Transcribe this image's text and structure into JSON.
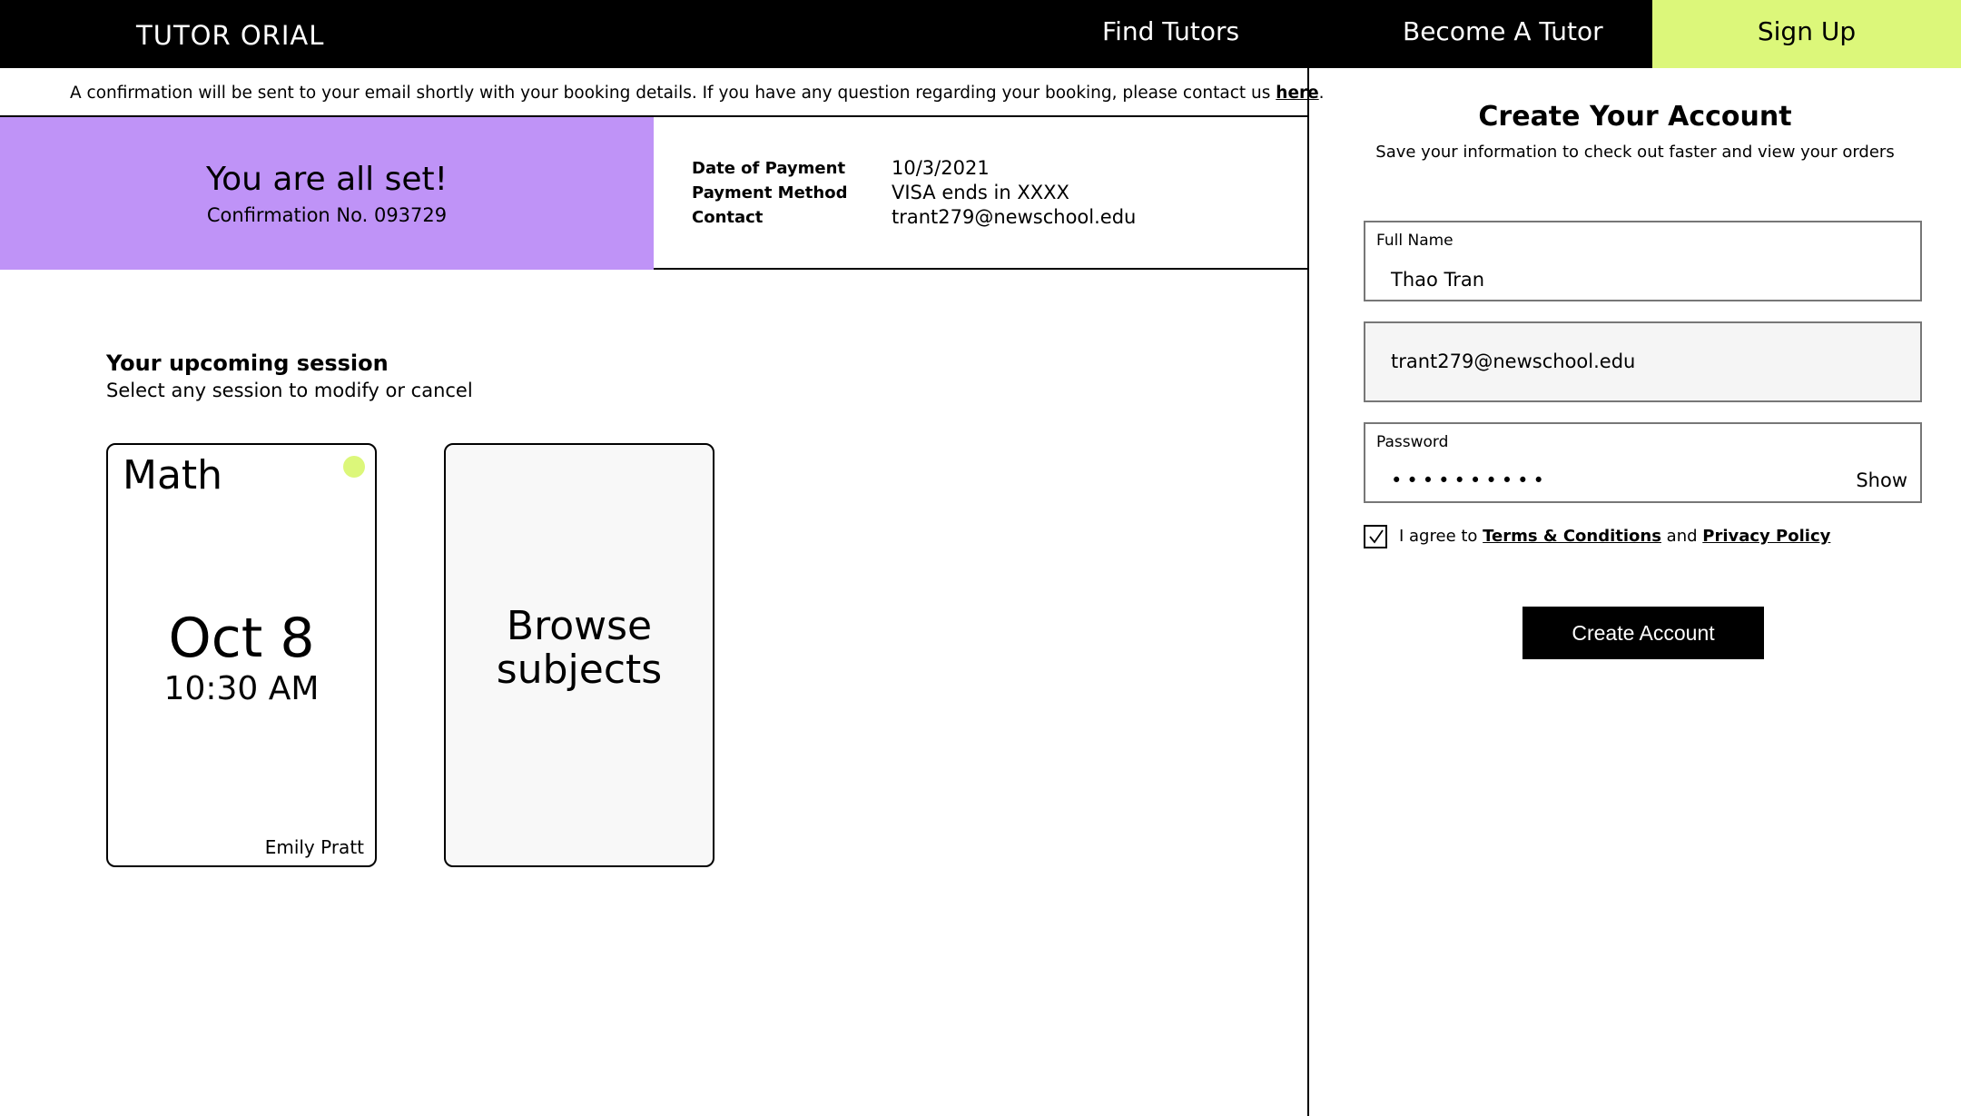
{
  "header": {
    "logo": "TUTOR ORIAL",
    "nav": {
      "find_tutors": "Find Tutors",
      "become_tutor": "Become A Tutor",
      "sign_up": "Sign Up"
    }
  },
  "notice": {
    "text": "A confirmation will be sent to your email shortly with your booking details. If you have any question regarding your booking, please contact us ",
    "link": "here",
    "end": "."
  },
  "confirmation": {
    "title": "You are all set!",
    "subtitle": "Confirmation No. 093729"
  },
  "payment": {
    "date_label": "Date of Payment",
    "date_value": "10/3/2021",
    "method_label": "Payment Method",
    "method_value": "VISA ends in XXXX",
    "contact_label": "Contact",
    "contact_value": "trant279@newschool.edu"
  },
  "sessions": {
    "title": "Your upcoming session",
    "subtitle": "Select any session to modify or cancel",
    "items": [
      {
        "subject": "Math",
        "date": "Oct 8",
        "time": "10:30 AM",
        "tutor": "Emily Pratt"
      }
    ],
    "browse_label": "Browse subjects"
  },
  "account": {
    "title": "Create Your Account",
    "subtitle": "Save your information to check out faster and view your orders",
    "full_name_label": "Full Name",
    "full_name_value": "Thao Tran",
    "email_value": "trant279@newschool.edu",
    "password_label": "Password",
    "password_mask": "••••••••••",
    "show_label": "Show",
    "agree_prefix": "I agree to ",
    "terms_link": "Terms & Conditions",
    "agree_and": " and ",
    "privacy_link": "Privacy Policy",
    "create_button": "Create Account"
  },
  "colors": {
    "accent_lime": "#dcf77a",
    "accent_purple": "#bf93f7",
    "nav_background": "#000000"
  }
}
